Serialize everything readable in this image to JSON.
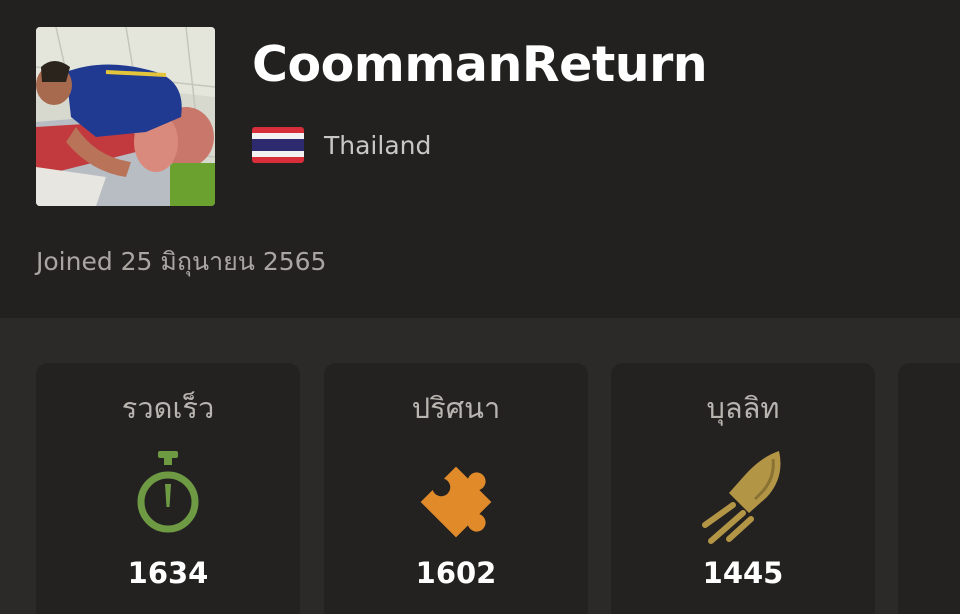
{
  "profile": {
    "username": "CoommanReturn",
    "country": "Thailand",
    "joined": "Joined 25 มิถุนายน 2565",
    "online_status_color": "#6aa12f"
  },
  "stats": [
    {
      "label": "รวดเร็ว",
      "value": "1634",
      "icon": "stopwatch-icon",
      "color": "#6f9a44"
    },
    {
      "label": "ปริศนา",
      "value": "1602",
      "icon": "puzzle-piece-icon",
      "color": "#e08a2a"
    },
    {
      "label": "บุลลิท",
      "value": "1445",
      "icon": "rocket-icon",
      "color": "#b39546"
    }
  ]
}
